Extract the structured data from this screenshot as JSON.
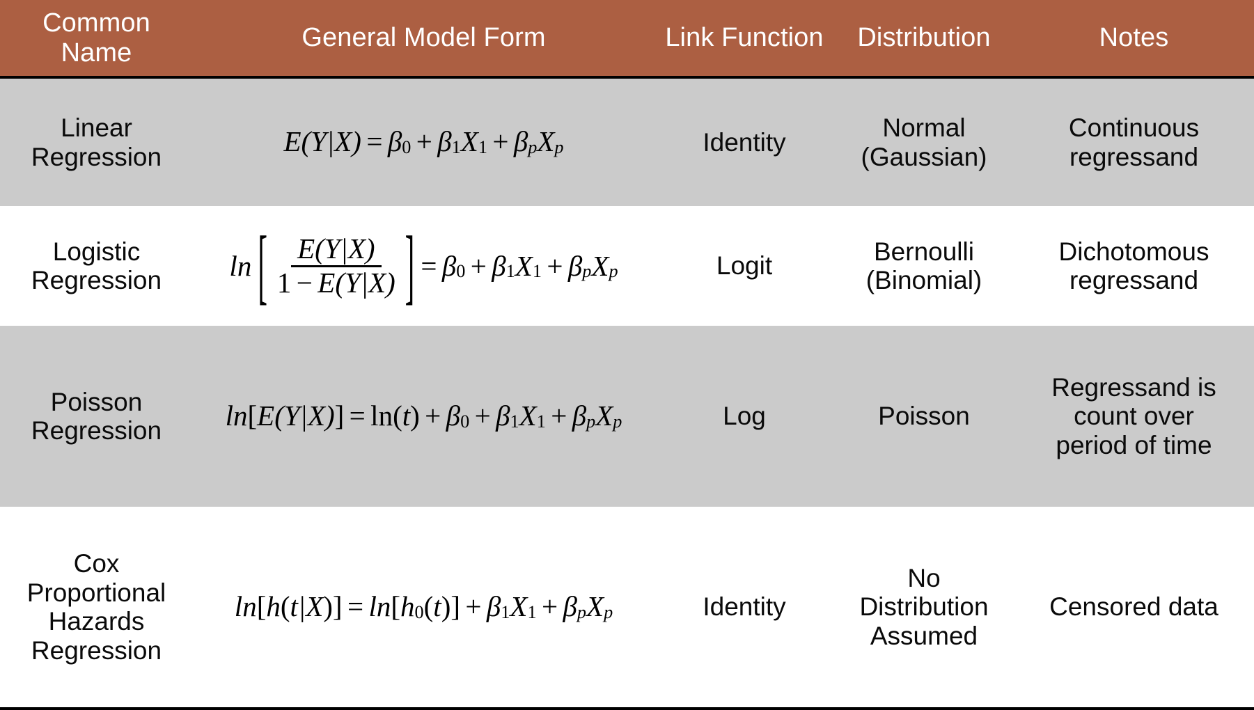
{
  "table": {
    "header": {
      "background_color": "#AC5F42",
      "text_color": "#FFFFFF",
      "columns": [
        "Common Name",
        "General Model Form",
        "Link Function",
        "Distribution",
        "Notes"
      ]
    },
    "row_shaded_color": "#CBCBCB",
    "row_plain_color": "#FFFFFF",
    "rows": [
      {
        "common_name": "Linear Regression",
        "general_model_form": "E(Y|X) = β₀ + β₁X₁ + βₚXₚ",
        "link_function": "Identity",
        "distribution": "Normal (Gaussian)",
        "notes": "Continuous regressand",
        "shaded": true
      },
      {
        "common_name": "Logistic Regression",
        "general_model_form": "ln[ E(Y|X) / (1 − E(Y|X)) ] = β₀ + β₁X₁ + βₚXₚ",
        "link_function": "Logit",
        "distribution": "Bernoulli (Binomial)",
        "notes": "Dichotomous regressand",
        "shaded": false
      },
      {
        "common_name": "Poisson Regression",
        "general_model_form": "ln[E(Y|X)] = ln(t) + β₀ + β₁X₁ + βₚXₚ",
        "link_function": "Log",
        "distribution": "Poisson",
        "notes": "Regressand is count over period of time",
        "shaded": true
      },
      {
        "common_name": "Cox Proportional Hazards Regression",
        "general_model_form": "ln[h(t|X)] = ln[h₀(t)] + β₁X₁ + βₚXₚ",
        "link_function": "Identity",
        "distribution": "No Distribution Assumed",
        "notes": "Censored data",
        "shaded": false
      }
    ],
    "name_lines": {
      "r1": [
        "Linear",
        "Regression"
      ],
      "r2": [
        "Logistic",
        "Regression"
      ],
      "r3": [
        "Poisson",
        "Regression"
      ],
      "r4": [
        "Cox",
        "Proportional",
        "Hazards",
        "Regression"
      ]
    },
    "dist_lines": {
      "r1": [
        "Normal",
        "(Gaussian)"
      ],
      "r2": [
        "Bernoulli",
        "(Binomial)"
      ],
      "r3": [
        "Poisson"
      ],
      "r4": [
        "No",
        "Distribution",
        "Assumed"
      ]
    },
    "notes_lines": {
      "r1": [
        "Continuous",
        "regressand"
      ],
      "r2": [
        "Dichotomous",
        "regressand"
      ],
      "r3": [
        "Regressand is",
        "count over",
        "period of time"
      ],
      "r4": [
        "Censored data"
      ]
    },
    "header_lines": {
      "common_name": [
        "Common",
        "Name"
      ],
      "general_model_form": [
        "General Model Form"
      ],
      "link_function": [
        "Link Function"
      ],
      "distribution": [
        "Distribution"
      ],
      "notes": [
        "Notes"
      ]
    },
    "math_tokens": {
      "ln": "ln",
      "E": "E",
      "Y": "Y",
      "X": "X",
      "h": "h",
      "t": "t",
      "beta": "β",
      "sub0": "0",
      "sub1": "1",
      "subp": "p",
      "eq": "=",
      "plus": "+",
      "minus": "−",
      "one": "1",
      "lbrack": "[",
      "rbrack": "]",
      "lparen": "(",
      "rparen": ")",
      "bar": "|"
    }
  }
}
